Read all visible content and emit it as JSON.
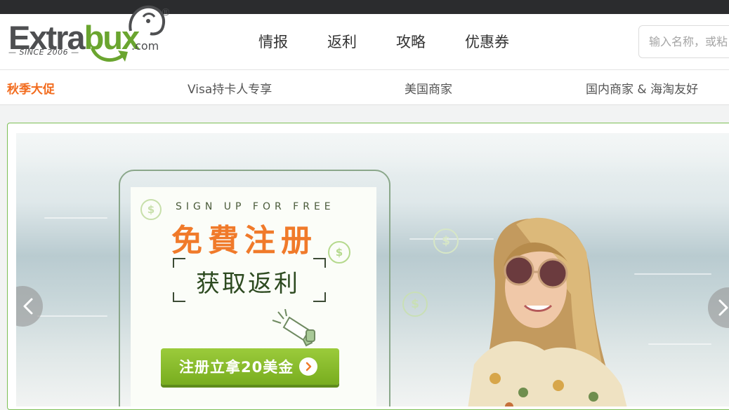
{
  "header": {
    "logo": {
      "brand_dark": "Extra",
      "brand_green": "bux",
      "registered": "®",
      "domain": ".com",
      "since": "— SINCE 2006 —"
    },
    "nav": [
      {
        "label": "情报"
      },
      {
        "label": "返利"
      },
      {
        "label": "攻略"
      },
      {
        "label": "优惠券"
      }
    ],
    "search": {
      "placeholder": "输入名称，或粘"
    }
  },
  "subnav": [
    {
      "label": "秋季大促",
      "active": true
    },
    {
      "label": "Visa持卡人专享",
      "active": false
    },
    {
      "label": "美国商家",
      "active": false
    },
    {
      "label": "国内商家 & 海淘友好",
      "active": false
    }
  ],
  "banner": {
    "signup_text": "SIGN UP FOR FREE",
    "headline": "免費注册",
    "subheadline": "获取返利",
    "cta_label": "注册立拿20美金",
    "coin_symbol": "$",
    "colors": {
      "headline": "#f07a2a",
      "cta": "#86bb2a",
      "frame": "#7cbf55",
      "active_subnav": "#f26b1d"
    },
    "icons": [
      "megaphone-icon",
      "coin-icon",
      "chevron-left-icon",
      "chevron-right-icon",
      "chevron-circle-right-icon"
    ]
  }
}
